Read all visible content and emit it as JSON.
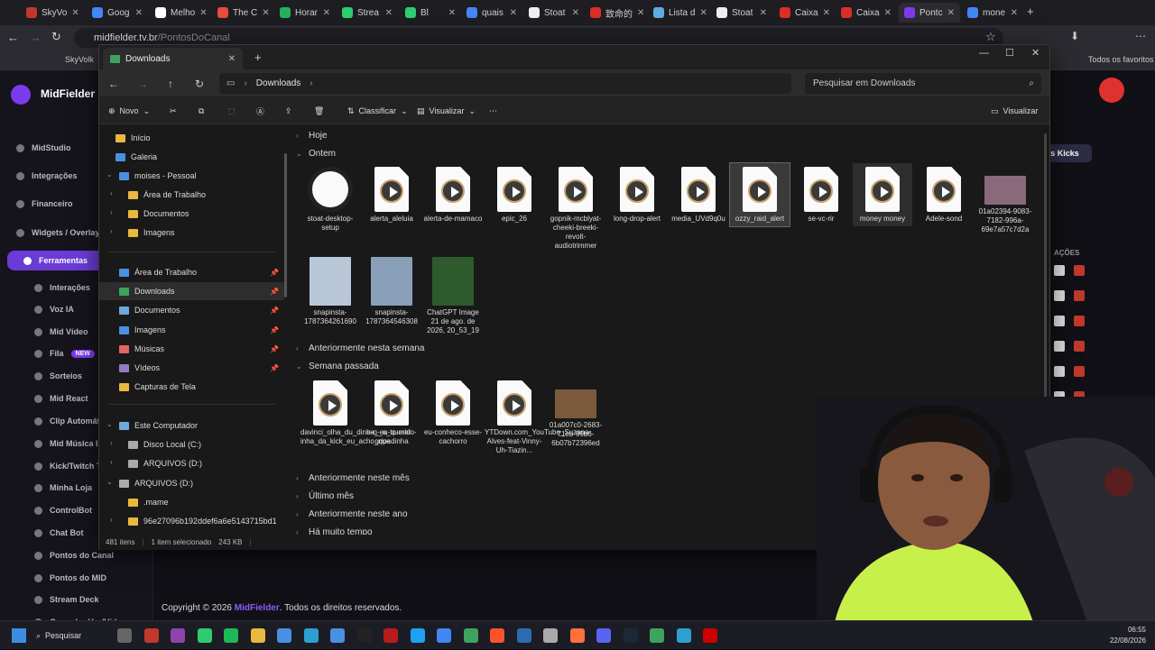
{
  "browser": {
    "tabs": [
      {
        "label": "SkyVo",
        "color": "#c0392b"
      },
      {
        "label": "Goog",
        "color": "#4285f4"
      },
      {
        "label": "Melho",
        "color": "#ffffff"
      },
      {
        "label": "The C",
        "color": "#e74c3c"
      },
      {
        "label": "Horar",
        "color": "#27ae60"
      },
      {
        "label": "Strea",
        "color": "#2ecc71"
      },
      {
        "label": "Bl",
        "color": "#2ecc71"
      },
      {
        "label": "quais",
        "color": "#4285f4"
      },
      {
        "label": "Stoat",
        "color": "#eeeeee"
      },
      {
        "label": "致命的",
        "color": "#d93025"
      },
      {
        "label": "Lista d",
        "color": "#5dade2"
      },
      {
        "label": "Stoat",
        "color": "#eeeeee"
      },
      {
        "label": "Caixa",
        "color": "#d93025"
      },
      {
        "label": "Caixa",
        "color": "#d93025"
      },
      {
        "label": "Pontc",
        "color": "#7c3aed"
      },
      {
        "label": "mone",
        "color": "#4285f4"
      }
    ],
    "address": {
      "domain": "midfielder.tv.br",
      "path": "/PontosDoCanal"
    },
    "bookmarks": {
      "first": "SkyVolk",
      "favorites": "Todos os favoritos"
    }
  },
  "site": {
    "brand": "MidFielder",
    "sidebar": [
      {
        "label": "MidStudio"
      },
      {
        "label": "Integrações"
      },
      {
        "label": "Financeiro"
      },
      {
        "label": "Widgets / Overlays"
      },
      {
        "label": "Ferramentas",
        "active": true
      },
      {
        "label": "Interações",
        "sub": true
      },
      {
        "label": "Voz IA",
        "sub": true
      },
      {
        "label": "Mid Vídeo",
        "sub": true
      },
      {
        "label": "Fila",
        "sub": true,
        "badge": "NEW"
      },
      {
        "label": "Sorteios",
        "sub": true
      },
      {
        "label": "Mid React",
        "sub": true
      },
      {
        "label": "Clip Automático",
        "sub": true
      },
      {
        "label": "Mid Música IA",
        "sub": true
      },
      {
        "label": "Kick/Twitch TTS",
        "sub": true
      },
      {
        "label": "Minha Loja",
        "sub": true
      },
      {
        "label": "ControlBot",
        "sub": true
      },
      {
        "label": "Chat Bot",
        "sub": true
      },
      {
        "label": "Pontos do Canal",
        "sub": true
      },
      {
        "label": "Pontos do MID",
        "sub": true
      },
      {
        "label": "Stream Deck",
        "sub": true
      },
      {
        "label": "Gravador Voz/Vídeo",
        "sub": true
      }
    ],
    "kicks_button": "s Kicks",
    "actions_header": "AÇÕES",
    "footer": {
      "prefix": "Copyright © 2026 ",
      "brand": "MidFielder",
      "suffix": ". Todos os direitos reservados."
    }
  },
  "explorer": {
    "tab_title": "Downloads",
    "breadcrumb": "Downloads",
    "search_placeholder": "Pesquisar em Downloads",
    "commands": {
      "new": "Novo",
      "sort": "Classificar",
      "view": "Visualizar",
      "preview": "Visualizar"
    },
    "nav": [
      {
        "label": "Início",
        "icon": "home"
      },
      {
        "label": "Galeria",
        "icon": "gallery"
      },
      {
        "label": "moises - Pessoal",
        "icon": "cloud"
      },
      {
        "label": "Área de Trabalho",
        "icon": "folder"
      },
      {
        "label": "Documentos",
        "icon": "folder"
      },
      {
        "label": "Imagens",
        "icon": "folder"
      },
      {
        "label": "Área de Trabalho",
        "icon": "desktop",
        "pinned": true
      },
      {
        "label": "Downloads",
        "icon": "download",
        "pinned": true,
        "selected": true
      },
      {
        "label": "Documentos",
        "icon": "docs",
        "pinned": true
      },
      {
        "label": "Imagens",
        "icon": "images",
        "pinned": true
      },
      {
        "label": "Músicas",
        "icon": "music",
        "pinned": true
      },
      {
        "label": "Vídeos",
        "icon": "video",
        "pinned": true
      },
      {
        "label": "Capturas de Tela",
        "icon": "folder"
      },
      {
        "label": "Este Computador",
        "icon": "pc"
      },
      {
        "label": "Disco Local (C:)",
        "icon": "drive"
      },
      {
        "label": "ARQUIVOS (D:)",
        "icon": "drive"
      },
      {
        "label": "ARQUIVOS (D:)",
        "icon": "drive"
      },
      {
        "label": ".mame",
        "icon": "folder"
      },
      {
        "label": "96e27096b192ddef6a6e5143715bd1",
        "icon": "folder"
      }
    ],
    "groups": [
      {
        "label": "Hoje",
        "expanded": false
      },
      {
        "label": "Ontem",
        "expanded": true
      },
      {
        "label": "Anteriormente nesta semana",
        "expanded": false
      },
      {
        "label": "Semana passada",
        "expanded": true
      },
      {
        "label": "Anteriormente neste mês",
        "expanded": false
      },
      {
        "label": "Último mês",
        "expanded": false
      },
      {
        "label": "Anteriormente neste ano",
        "expanded": false
      },
      {
        "label": "Há muito tempo",
        "expanded": false
      }
    ],
    "files_yesterday": [
      {
        "name": "stoat-desktop-setup",
        "kind": "app"
      },
      {
        "name": "alerta_aleluia",
        "kind": "media"
      },
      {
        "name": "alerta-de-mamaco",
        "kind": "media"
      },
      {
        "name": "epic_26",
        "kind": "media"
      },
      {
        "name": "gopnik-mcblyat-cheeki-breeki-revolt-audiotrimmer",
        "kind": "media"
      },
      {
        "name": "long-drop-alert",
        "kind": "media"
      },
      {
        "name": "media_UVd9q0u",
        "kind": "media"
      },
      {
        "name": "ozzy_raid_alert",
        "kind": "media",
        "selected": true
      },
      {
        "name": "se-vc-rir",
        "kind": "media"
      },
      {
        "name": "money money",
        "kind": "media",
        "hover": true
      },
      {
        "name": "Adele-sond",
        "kind": "media"
      },
      {
        "name": "01a02394-9083-7182-996a-69e7a57c7d2a",
        "kind": "image",
        "color": "#8a6a7a"
      },
      {
        "name": "snapinsta-1787364261690",
        "kind": "image",
        "color": "#b8c8d8"
      },
      {
        "name": "snapinsta-1787364546308",
        "kind": "image",
        "color": "#8aa0b8"
      },
      {
        "name": "ChatGPT Image 21 de ago. de 2026, 20_53_19",
        "kind": "image",
        "color": "#2e5a2e"
      }
    ],
    "files_lastweek": [
      {
        "name": "davinci_olha_du_dinha__a_querid inha_da_kick_eu_acho_que",
        "kind": "media"
      },
      {
        "name": "e-q-eu-to-meio-gripadinha",
        "kind": "media"
      },
      {
        "name": "eu-conheco-esse-cachorro",
        "kind": "media"
      },
      {
        "name": "YTDown.com_YouTube_Suzana-Alves-feat-Vinny-Uh-Tiazin...",
        "kind": "media"
      },
      {
        "name": "01a007c0-2683-71eb-99b6-6b07b72396ed",
        "kind": "image",
        "color": "#7a5a3a"
      }
    ],
    "status": {
      "count": "481 itens",
      "selection": "1 item selecionado",
      "size": "243 KB"
    }
  },
  "taskbar": {
    "search": "Pesquisar",
    "time": "06:55",
    "date": "22/08/2026"
  }
}
